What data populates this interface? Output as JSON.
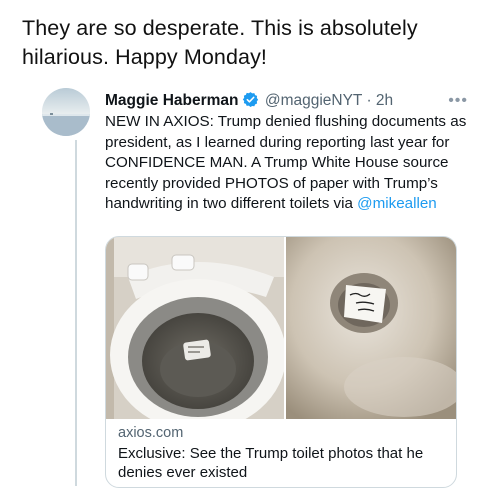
{
  "post": {
    "text": "They are so desperate. This is absolutely hilarious. Happy Monday!"
  },
  "quoted_tweet": {
    "author_name": "Maggie Haberman",
    "handle": "@maggieNYT",
    "separator": "·",
    "time": "2h",
    "more_icon": "more-horizontal-icon",
    "verified_icon": "verified-badge-icon",
    "verified_color": "#1d9bf0",
    "body_text": "NEW IN AXIOS: Trump denied flushing documents as president, as I learned during reporting last year for CONFIDENCE MAN. A Trump White House source recently provided PHOTOS of paper with Trump’s handwriting in two different toilets via",
    "mention": "@mikeallen",
    "link_card": {
      "domain": "axios.com",
      "title": "Exclusive: See the Trump toilet photos that he denies ever existed"
    }
  }
}
